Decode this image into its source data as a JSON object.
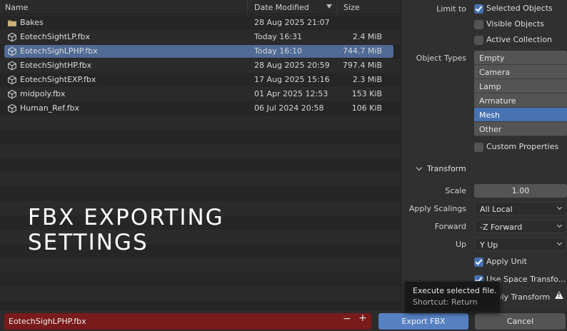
{
  "columns": {
    "name": "Name",
    "date": "Date Modified",
    "size": "Size"
  },
  "files": [
    {
      "name": "Bakes",
      "date": "28 Aug 2025 21:07",
      "size": "",
      "type": "folder",
      "selected": false
    },
    {
      "name": "EotechSightLP.fbx",
      "date": "Today 16:31",
      "size": "2.4 MiB",
      "type": "mesh",
      "selected": false
    },
    {
      "name": "EotechSighLPHP.fbx",
      "date": "Today 16:10",
      "size": "744.7 MiB",
      "type": "mesh",
      "selected": true
    },
    {
      "name": "EotechSightHP.fbx",
      "date": "28 Aug 2025 20:59",
      "size": "797.4 MiB",
      "type": "mesh",
      "selected": false
    },
    {
      "name": "EotechSightEXP.fbx",
      "date": "17 Aug 2025 15:16",
      "size": "2.3 MiB",
      "type": "mesh",
      "selected": false
    },
    {
      "name": "midpoly.fbx",
      "date": "01 Apr 2025 12:53",
      "size": "153 KiB",
      "type": "mesh",
      "selected": false
    },
    {
      "name": "Human_Ref.fbx",
      "date": "06 Jul 2024 20:58",
      "size": "106 KiB",
      "type": "mesh",
      "selected": false
    }
  ],
  "overlay": {
    "line1": "FBX EXPORTING",
    "line2": "SETTINGS"
  },
  "panel": {
    "limit_to_label": "Limit to",
    "limit_options": [
      {
        "label": "Selected Objects",
        "checked": true
      },
      {
        "label": "Visible Objects",
        "checked": false
      },
      {
        "label": "Active Collection",
        "checked": false
      }
    ],
    "object_types_label": "Object Types",
    "object_types": [
      {
        "label": "Empty",
        "active": false
      },
      {
        "label": "Camera",
        "active": false
      },
      {
        "label": "Lamp",
        "active": false
      },
      {
        "label": "Armature",
        "active": false
      },
      {
        "label": "Mesh",
        "active": true
      },
      {
        "label": "Other",
        "active": false
      }
    ],
    "custom_properties": {
      "label": "Custom Properties",
      "checked": false
    },
    "transform": {
      "header": "Transform",
      "scale_label": "Scale",
      "scale_value": "1.00",
      "apply_scalings_label": "Apply Scalings",
      "apply_scalings_value": "All Local",
      "forward_label": "Forward",
      "forward_value": "-Z Forward",
      "up_label": "Up",
      "up_value": "Y Up",
      "apply_unit": {
        "label": "Apply Unit",
        "checked": true
      },
      "use_space_transform": {
        "label": "Use Space Transfo...",
        "checked": true
      },
      "apply_transform": {
        "label": "Apply Transform",
        "checked": false
      }
    }
  },
  "bottom": {
    "filename": "EotechSighLPHP.fbx",
    "minus": "−",
    "plus": "+",
    "export_label": "Export FBX",
    "cancel_label": "Cancel"
  },
  "tooltip": {
    "title": "Execute selected file.",
    "shortcut": "Shortcut: Return"
  },
  "colors": {
    "selection": "#4f6a94",
    "accent": "#4772b3",
    "export_button": "#5680c2",
    "filename_error": "#7a1b1b"
  }
}
